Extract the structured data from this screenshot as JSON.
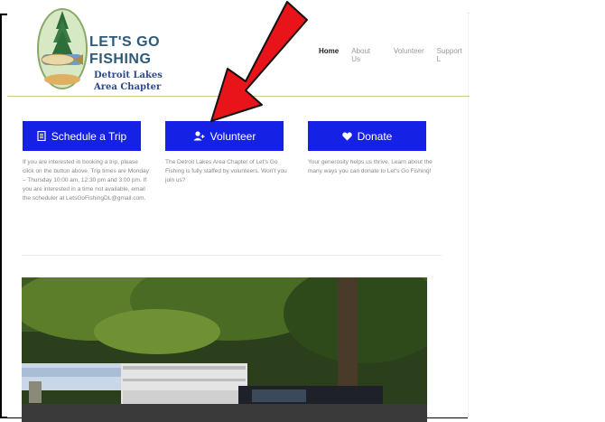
{
  "logo": {
    "line1": "LET'S GO",
    "line2": "FISHING",
    "line3": "Detroit Lakes",
    "line4": "Area Chapter"
  },
  "nav": {
    "items": [
      "Home",
      "About Us",
      "Volunteer",
      "Support L"
    ]
  },
  "cards": [
    {
      "button": "Schedule a Trip",
      "icon": "document-icon",
      "text": "If you are interested in booking a trip, please click on the button above. Trip times are Monday – Thursday 10:00 am, 12:30 pm and 3:00 pm. If you are interested in a time not available, email the scheduler at LetsGoFishingDL@gmail.com."
    },
    {
      "button": "Volunteer",
      "icon": "user-plus-icon",
      "text": "The Detroit Lakes Area Chapter of Let's Go Fishing is fully staffed by volunteers. Won't you join us?"
    },
    {
      "button": "Donate",
      "icon": "heart-icon",
      "text": "Your generosity helps us thrive. Learn about the many ways you can donate to Let's Go Fishing!"
    }
  ],
  "colors": {
    "button_bg": "#1621e6",
    "annotation_arrow": "#e8141a"
  }
}
